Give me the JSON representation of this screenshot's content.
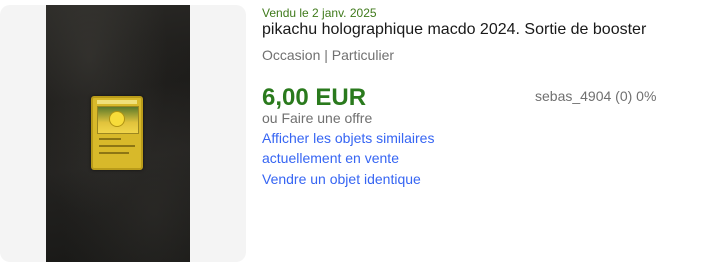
{
  "listing": {
    "sold_date": "Vendu le 2 janv. 2025",
    "title": "pikachu holographique macdo 2024. Sortie de booster",
    "condition": "Occasion | Particulier",
    "price": "6,00 EUR",
    "offer": "ou Faire une offre",
    "seller": "sebas_4904 (0) 0%",
    "links": {
      "similar_line1": "Afficher les objets similaires",
      "similar_line2": "actuellement en vente",
      "sell_identical": "Vendre un objet identique"
    },
    "colors": {
      "sold_green": "#3f7a1b",
      "price_green": "#2a7a1d",
      "link_blue": "#3665f3",
      "muted_gray": "#707070"
    },
    "image": {
      "description_icon": "pokemon-card-photo"
    }
  }
}
